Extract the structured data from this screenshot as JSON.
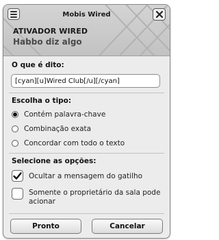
{
  "window": {
    "title": "Mobis Wired"
  },
  "header": {
    "title": "ATIVADOR WIRED",
    "subtitle": "Habbo diz algo"
  },
  "text_section": {
    "label": "O que é dito:",
    "value": "[cyan][u]Wired Club[/u][/cyan]"
  },
  "type_section": {
    "label": "Escolha o tipo:",
    "options": [
      {
        "label": "Contém palavra-chave",
        "selected": true
      },
      {
        "label": "Combinação exata",
        "selected": false
      },
      {
        "label": "Concordar com todo o texto",
        "selected": false
      }
    ]
  },
  "options_section": {
    "label": "Selecione as opções:",
    "checkboxes": [
      {
        "label": "Ocultar a mensagem do gatilho",
        "checked": true
      },
      {
        "label": "Somente o proprietário da sala pode acionar",
        "checked": false
      }
    ]
  },
  "buttons": {
    "ok": "Pronto",
    "cancel": "Cancelar"
  }
}
